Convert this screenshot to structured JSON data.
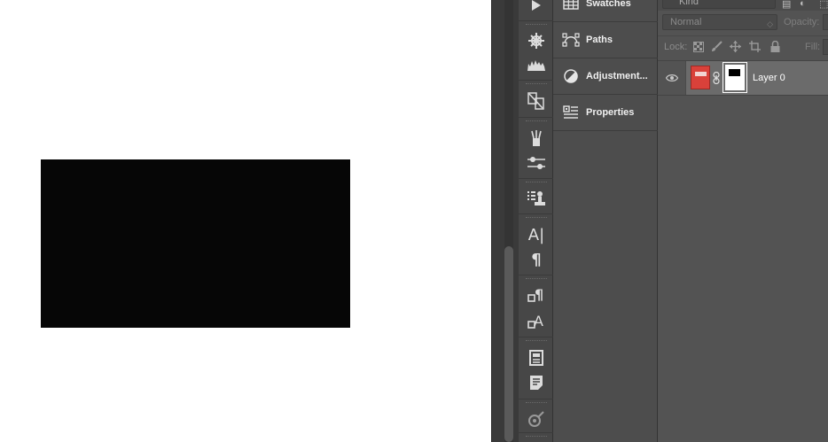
{
  "colors": {
    "canvas_bg": "#ffffff",
    "shape_fill": "#060606",
    "panel_bg": "#535353",
    "layer_selected_bg": "#6b6b6b",
    "thumb_red": "#d9413a"
  },
  "filter": {
    "kind_label": "Kind"
  },
  "blend": {
    "mode": "Normal",
    "opacity_label": "Opacity:"
  },
  "lock": {
    "label": "Lock:",
    "fill_label": "Fill:"
  },
  "panels": [
    {
      "label": "Swatches",
      "icon": "grid-icon"
    },
    {
      "label": "Paths",
      "icon": "paths-icon"
    },
    {
      "label": "Adjustment...",
      "icon": "adjustment-icon"
    },
    {
      "label": "Properties",
      "icon": "properties-icon"
    }
  ],
  "strip_icons": [
    "play-icon",
    "navigator-icon",
    "histogram-icon",
    "clone-source-icon",
    "brushes-icon",
    "brush-settings-icon",
    "tool-presets-icon",
    "character-icon",
    "paragraph-icon",
    "paragraph-styles-icon",
    "character-styles-icon",
    "notes-icon",
    "info-icon",
    "3d-icon"
  ],
  "strip_text": {
    "character": "A|",
    "paragraph": "¶",
    "par_style": "¶",
    "char_style": "A"
  },
  "layer": {
    "name": "Layer 0"
  }
}
